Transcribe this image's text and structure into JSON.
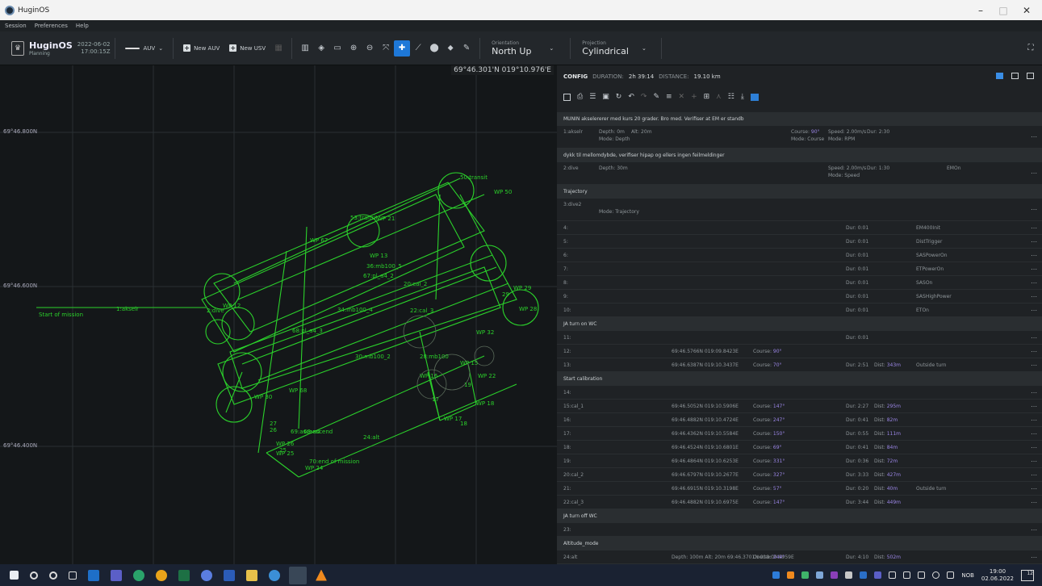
{
  "window": {
    "title": "HuginOS",
    "minimize": "–",
    "maximize": "□",
    "close": "✕"
  },
  "menu": [
    "Session",
    "Preferences",
    "Help"
  ],
  "toolbar": {
    "brand_name": "HuginOS",
    "brand_sub": "Planning",
    "date": "2022-06-02",
    "time": "17:00:15Z",
    "vehicle_label": "AUV",
    "new_auv": "New AUV",
    "new_usv": "New USV",
    "orientation_label": "Orientation",
    "orientation_value": "North Up",
    "projection_label": "Projection",
    "projection_value": "Cylindrical"
  },
  "map": {
    "cursor_coord": "69°46.301'N 019°10.976'E",
    "lat_labels": [
      "69°46.800N",
      "69°46.600N",
      "69°46.400N"
    ],
    "labels": [
      "Start of mission",
      "1:akselr",
      "2:dive",
      "WP 12",
      "WP 67",
      "WP 21",
      "WP 13",
      "WP 68",
      "WP 30",
      "WP 16",
      "WP 22",
      "WP 18",
      "WP 17",
      "WP 29",
      "WP 28",
      "WP 15",
      "WP 26",
      "WP 25",
      "WP 24",
      "WP 32",
      "WP 50",
      "50:transit",
      "53:transit",
      "34:mb100_4",
      "36:mb100_5",
      "30:mb100_2",
      "28:mb100",
      "68:pl_a4_3",
      "67:pl_a4_2",
      "20:cal_2",
      "22:cal_3",
      "68:ascend",
      "24:alt",
      "70:end of mission",
      "69:ascend",
      "19",
      "17",
      "18",
      "27",
      "26",
      "25",
      "29"
    ]
  },
  "config": {
    "title": "CONFIG",
    "duration_label": "DURATION:",
    "duration_value": "2h 39:14",
    "distance_label": "DISTANCE:",
    "distance_value": "19.10 km",
    "rows": [
      {
        "kind": "group",
        "text": "MUNIN akselererer med kurs 20 grader. Bro med. Verifiser at EM er standb"
      },
      {
        "kind": "tall",
        "id": "1:akselr",
        "a": "Depth: 0m",
        "a2": "Mode: Depth",
        "b": "Alt: 20m",
        "course": "Course: 90°",
        "course2": "Mode: Course",
        "speed": "Speed: 2.00m/s",
        "speed2": "Mode: RPM",
        "dur": "Dur: 2:30",
        "extra": ""
      },
      {
        "kind": "group",
        "text": "dykk til mellomdybde, verifiser hipap og ellers ingen feilmeldinger"
      },
      {
        "kind": "tall",
        "id": "2:dive",
        "a": "Depth: 30m",
        "a2": "",
        "b": "",
        "course": "",
        "course2": "",
        "speed": "Speed: 2.00m/s",
        "speed2": "Mode: Speed",
        "dur": "Dur: 1:30",
        "extra": "EMOn"
      },
      {
        "kind": "group",
        "text": "Trajectory"
      },
      {
        "kind": "tall",
        "id": "3:dive2",
        "a": "",
        "a2": "Mode: Trajectory",
        "b": "",
        "course": "",
        "course2": "",
        "speed": "",
        "speed2": "",
        "dur": "",
        "extra": ""
      },
      {
        "kind": "row",
        "id": "4:",
        "pos": "",
        "course": "",
        "dur": "Dur: 0:01",
        "dist": "",
        "extra": "EM400Init"
      },
      {
        "kind": "row",
        "id": "5:",
        "pos": "",
        "course": "",
        "dur": "Dur: 0:01",
        "dist": "",
        "extra": "DistTrigger"
      },
      {
        "kind": "row",
        "id": "6:",
        "pos": "",
        "course": "",
        "dur": "Dur: 0:01",
        "dist": "",
        "extra": "SASPowerOn"
      },
      {
        "kind": "row",
        "id": "7:",
        "pos": "",
        "course": "",
        "dur": "Dur: 0:01",
        "dist": "",
        "extra": "ETPowerOn"
      },
      {
        "kind": "row",
        "id": "8:",
        "pos": "",
        "course": "",
        "dur": "Dur: 0:01",
        "dist": "",
        "extra": "SASOn"
      },
      {
        "kind": "row",
        "id": "9:",
        "pos": "",
        "course": "",
        "dur": "Dur: 0:01",
        "dist": "",
        "extra": "SASHighPower"
      },
      {
        "kind": "row",
        "id": "10:",
        "pos": "",
        "course": "",
        "dur": "Dur: 0:01",
        "dist": "",
        "extra": "ETOn"
      },
      {
        "kind": "group",
        "text": "JA turn on WC"
      },
      {
        "kind": "row",
        "id": "11:",
        "pos": "",
        "course": "",
        "dur": "Dur: 0:01",
        "dist": "",
        "extra": ""
      },
      {
        "kind": "row",
        "id": "12:",
        "pos": "69:46.5766N 019:09.8423E",
        "course": "Course: 90°",
        "dur": "",
        "dist": "",
        "extra": ""
      },
      {
        "kind": "row",
        "id": "13:",
        "pos": "69:46.6387N 019:10.3437E",
        "course": "Course: 70°",
        "dur": "Dur: 2:51",
        "dist": "Dist: 343m",
        "extra": "Outside turn"
      },
      {
        "kind": "group",
        "text": "Start calibration"
      },
      {
        "kind": "row",
        "id": "14:",
        "pos": "",
        "course": "",
        "dur": "",
        "dist": "",
        "extra": ""
      },
      {
        "kind": "row",
        "id": "15:cal_1",
        "pos": "69:46.5052N 019:10.5906E",
        "course": "Course: 147°",
        "dur": "Dur: 2:27",
        "dist": "Dist: 295m",
        "extra": ""
      },
      {
        "kind": "row",
        "id": "16:",
        "pos": "69:46.4882N 019:10.4724E",
        "course": "Course: 247°",
        "dur": "Dur: 0:41",
        "dist": "Dist: 82m",
        "extra": ""
      },
      {
        "kind": "row",
        "id": "17:",
        "pos": "69:46.4362N 019:10.5584E",
        "course": "Course: 150°",
        "dur": "Dur: 0:55",
        "dist": "Dist: 111m",
        "extra": ""
      },
      {
        "kind": "row",
        "id": "18:",
        "pos": "69:46.4524N 019:10.6801E",
        "course": "Course: 69°",
        "dur": "Dur: 0:41",
        "dist": "Dist: 84m",
        "extra": ""
      },
      {
        "kind": "row",
        "id": "19:",
        "pos": "69:46.4864N 019:10.6253E",
        "course": "Course: 331°",
        "dur": "Dur: 0:36",
        "dist": "Dist: 72m",
        "extra": ""
      },
      {
        "kind": "row",
        "id": "20:cal_2",
        "pos": "69:46.6797N 019:10.2677E",
        "course": "Course: 327°",
        "dur": "Dur: 3:33",
        "dist": "Dist: 427m",
        "extra": ""
      },
      {
        "kind": "row",
        "id": "21:",
        "pos": "69:46.6915N 019:10.3198E",
        "course": "Course: 57°",
        "dur": "Dur: 0:20",
        "dist": "Dist: 40m",
        "extra": "Outside turn"
      },
      {
        "kind": "row",
        "id": "22:cal_3",
        "pos": "69:46.4882N 019:10.6975E",
        "course": "Course: 147°",
        "dur": "Dur: 3:44",
        "dist": "Dist: 449m",
        "extra": ""
      },
      {
        "kind": "group",
        "text": "JA turn off WC"
      },
      {
        "kind": "row",
        "id": "23:",
        "pos": "",
        "course": "",
        "dur": "",
        "dist": "",
        "extra": ""
      },
      {
        "kind": "group",
        "text": "Altitude_mode"
      },
      {
        "kind": "row",
        "id": "24:alt",
        "pos": "Depth: 100m  Alt: 20m  69:46.3701N 019:09.9959E",
        "course": "Course: 244°",
        "dur": "Dur: 4:10",
        "dist": "Dist: 502m",
        "extra": ""
      }
    ]
  },
  "taskbar": {
    "lang": "NOB",
    "time": "19:00",
    "date": "02.06.2022",
    "notif": "12"
  },
  "colors": {
    "accent": "#1e78d8",
    "track": "#2bd12b",
    "purple": "#9b86e6"
  }
}
